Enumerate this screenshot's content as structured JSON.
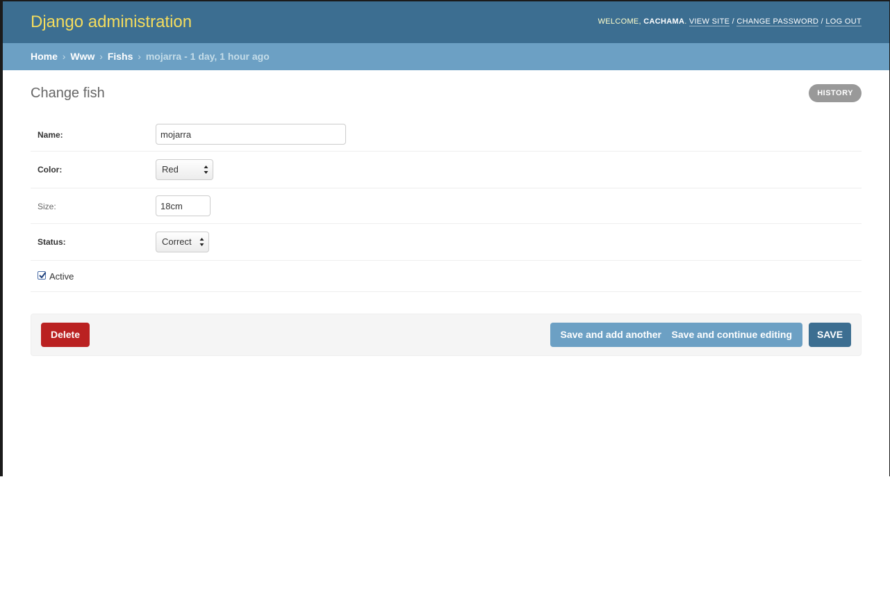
{
  "header": {
    "brand": "Django administration",
    "welcome": "Welcome,",
    "username": "cachama",
    "username_suffix": ".",
    "view_site": "View site",
    "change_password": "Change password",
    "log_out": "Log out",
    "separator": "/"
  },
  "breadcrumbs": {
    "items": [
      "Home",
      "Www",
      "Fishs"
    ],
    "separator": "›",
    "current": "mojarra - 1 day, 1 hour ago"
  },
  "page": {
    "title": "Change fish",
    "history_label": "History"
  },
  "form": {
    "name": {
      "label": "Name:",
      "value": "mojarra"
    },
    "color": {
      "label": "Color:",
      "selected": "Red"
    },
    "size": {
      "label": "Size:",
      "value": "18cm"
    },
    "status": {
      "label": "Status:",
      "selected": "Correct"
    },
    "active": {
      "label": "Active",
      "checked": true
    }
  },
  "submit": {
    "delete": "Delete",
    "save_add": "Save and add another",
    "save_continue": "Save and continue editing",
    "save": "SAVE"
  },
  "colors": {
    "header_bg": "#3c6e91",
    "brand": "#f5dd5d",
    "breadcrumbs_bg": "#6ca0c4",
    "delete_bg": "#ba2121",
    "save_bg": "#3c6e91"
  }
}
